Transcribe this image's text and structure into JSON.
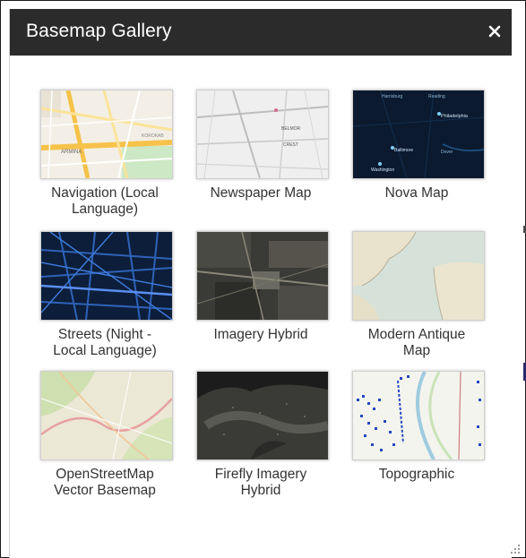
{
  "window": {
    "title": "Basemap Gallery",
    "close_label": "×"
  },
  "basemaps": [
    {
      "name": "navigation",
      "label_line1": "Navigation (Local",
      "label_line2": "Language)",
      "thumb_icon": "navigation-map-thumbnail"
    },
    {
      "name": "newspaper",
      "label_line1": "Newspaper Map",
      "label_line2": "",
      "thumb_icon": "newspaper-map-thumbnail"
    },
    {
      "name": "nova",
      "label_line1": "Nova Map",
      "label_line2": "",
      "thumb_icon": "nova-map-thumbnail"
    },
    {
      "name": "streets-night",
      "label_line1": "Streets (Night -",
      "label_line2": "Local Language)",
      "thumb_icon": "streets-night-map-thumbnail"
    },
    {
      "name": "imagery-hybrid",
      "label_line1": "Imagery Hybrid",
      "label_line2": "",
      "thumb_icon": "imagery-hybrid-map-thumbnail"
    },
    {
      "name": "modern-antique",
      "label_line1": "Modern Antique",
      "label_line2": "Map",
      "thumb_icon": "modern-antique-map-thumbnail"
    },
    {
      "name": "openstreetmap-vector",
      "label_line1": "OpenStreetMap",
      "label_line2": "Vector Basemap",
      "thumb_icon": "openstreetmap-map-thumbnail"
    },
    {
      "name": "firefly-imagery-hybrid",
      "label_line1": "Firefly Imagery",
      "label_line2": "Hybrid",
      "thumb_icon": "firefly-map-thumbnail"
    },
    {
      "name": "topographic",
      "label_line1": "Topographic",
      "label_line2": "",
      "thumb_icon": "topographic-map-thumbnail"
    }
  ],
  "thumb_text": {
    "nav_a": "ARMINA",
    "nav_b": "KOROKAB",
    "np_a": "BELMOR",
    "np_b": "CREST",
    "nova_a": "Harrisburg",
    "nova_b": "Reading",
    "nova_c": "Philadelphia",
    "nova_d": "Baltimore",
    "nova_e": "Dover",
    "nova_f": "Washington"
  },
  "colors": {
    "titlebar": "#2b2b2b",
    "title_text": "#ffffff",
    "label_text": "#333333"
  }
}
